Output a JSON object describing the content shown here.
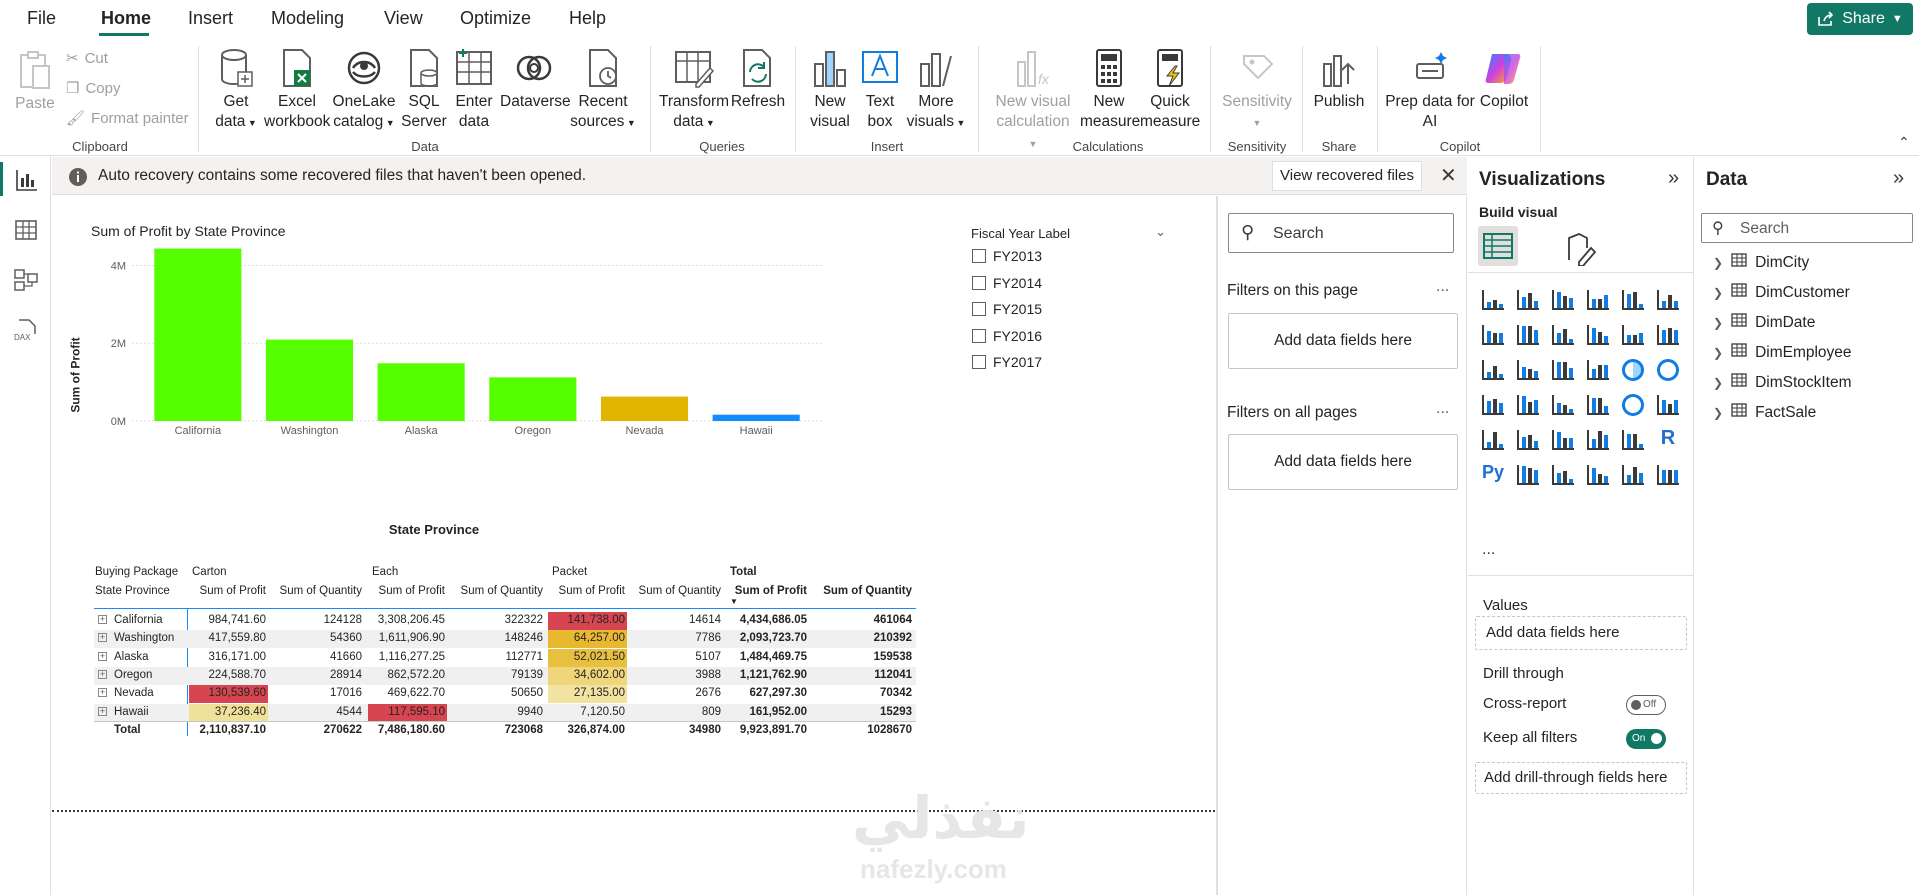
{
  "menu": {
    "tabs": [
      "File",
      "Home",
      "Insert",
      "Modeling",
      "View",
      "Optimize",
      "Help"
    ],
    "share": "Share"
  },
  "ribbon": {
    "clipboard": {
      "paste": "Paste",
      "cut": "Cut",
      "copy": "Copy",
      "format_painter": "Format painter",
      "group": "Clipboard"
    },
    "data": {
      "get_data": [
        "Get",
        "data"
      ],
      "excel": [
        "Excel",
        "workbook"
      ],
      "onelake": [
        "OneLake",
        "catalog"
      ],
      "sql": [
        "SQL",
        "Server"
      ],
      "enter": [
        "Enter",
        "data"
      ],
      "dataverse": "Dataverse",
      "recent": [
        "Recent",
        "sources"
      ],
      "group": "Data"
    },
    "queries": {
      "transform": [
        "Transform",
        "data"
      ],
      "refresh": "Refresh",
      "group": "Queries"
    },
    "insert": {
      "new_visual": [
        "New",
        "visual"
      ],
      "text_box": [
        "Text",
        "box"
      ],
      "more_visuals": [
        "More",
        "visuals"
      ],
      "group": "Insert"
    },
    "calculations": {
      "new_visual_calc": [
        "New visual",
        "calculation"
      ],
      "new_measure": [
        "New",
        "measure"
      ],
      "quick_measure": [
        "Quick",
        "measure"
      ],
      "group": "Calculations"
    },
    "sensitivity": {
      "label": "Sensitivity",
      "group": "Sensitivity"
    },
    "share": {
      "publish": "Publish",
      "group": "Share"
    },
    "copilot": {
      "prep": [
        "Prep data for",
        "AI"
      ],
      "copilot": "Copilot",
      "group": "Copilot"
    }
  },
  "notification": {
    "text": "Auto recovery contains some recovered files that haven't been opened.",
    "button": "View recovered files"
  },
  "chart_data": {
    "type": "bar",
    "title": "Sum of Profit by State Province",
    "xlabel": "State Province",
    "ylabel": "Sum of Profit",
    "categories": [
      "California",
      "Washington",
      "Alaska",
      "Oregon",
      "Nevada",
      "Hawaii"
    ],
    "values": [
      4434686.05,
      2093723.7,
      1484469.75,
      1121762.9,
      627297.3,
      161952.0
    ],
    "colors": [
      "#55ff00",
      "#55ff00",
      "#55ff00",
      "#55ff00",
      "#e1b400",
      "#118dff"
    ],
    "yticks": [
      "4M",
      "2M",
      "0M"
    ],
    "ylim": [
      0,
      4500000
    ]
  },
  "slicer": {
    "title": "Fiscal Year Label",
    "items": [
      "FY2013",
      "FY2014",
      "FY2015",
      "FY2016",
      "FY2017"
    ]
  },
  "matrix": {
    "header1": [
      "Buying Package",
      "Carton",
      "",
      "Each",
      "",
      "Packet",
      "",
      "Total",
      ""
    ],
    "header2": [
      "State Province",
      "Sum of Profit",
      "Sum of Quantity",
      "Sum of Profit",
      "Sum of Quantity",
      "Sum of Profit",
      "Sum of Quantity",
      "Sum of Profit",
      "Sum of Quantity"
    ],
    "rows": [
      [
        "California",
        "984,741.60",
        "124128",
        "3,308,206.45",
        "322322",
        "141,738.00",
        "14614",
        "4,434,686.05",
        "461064"
      ],
      [
        "Washington",
        "417,559.80",
        "54360",
        "1,611,906.90",
        "148246",
        "64,257.00",
        "7786",
        "2,093,723.70",
        "210392"
      ],
      [
        "Alaska",
        "316,171.00",
        "41660",
        "1,116,277.25",
        "112771",
        "52,021.50",
        "5107",
        "1,484,469.75",
        "159538"
      ],
      [
        "Oregon",
        "224,588.70",
        "28914",
        "862,572.20",
        "79139",
        "34,602.00",
        "3988",
        "1,121,762.90",
        "112041"
      ],
      [
        "Nevada",
        "130,539.60",
        "17016",
        "469,622.70",
        "50650",
        "27,135.00",
        "2676",
        "627,297.30",
        "70342"
      ],
      [
        "Hawaii",
        "37,236.40",
        "4544",
        "117,595.10",
        "9940",
        "7,120.50",
        "809",
        "161,952.00",
        "15293"
      ]
    ],
    "total": [
      "Total",
      "2,110,837.10",
      "270622",
      "7,486,180.60",
      "723068",
      "326,874.00",
      "34980",
      "9,923,891.70",
      "1028670"
    ],
    "highlights": {
      "carton": [
        "",
        "",
        "",
        "",
        "#d64550",
        "#f0e199"
      ],
      "each": [
        "",
        "",
        "",
        "",
        "",
        "#d64550"
      ],
      "packet": [
        "#d64550",
        "#e8b830",
        "#e8c040",
        "#f0d67a",
        "#f3e3a0",
        ""
      ]
    }
  },
  "filters": {
    "search": "Search",
    "on_page": "Filters on this page",
    "on_all": "Filters on all pages",
    "add": "Add data fields here",
    "dots": "..."
  },
  "viz": {
    "title": "Visualizations",
    "build": "Build visual",
    "values": "Values",
    "add_fields": "Add data fields here",
    "drill": "Drill through",
    "cross": "Cross-report",
    "cross_state": "Off",
    "keep": "Keep all filters",
    "keep_state": "On",
    "add_drill": "Add drill-through fields here",
    "more": "..."
  },
  "data": {
    "title": "Data",
    "search": "Search",
    "tables": [
      "DimCity",
      "DimCustomer",
      "DimDate",
      "DimEmployee",
      "DimStockItem",
      "FactSale"
    ]
  },
  "watermark": {
    "arabic": "نفذلي",
    "latin": "nafezly.com"
  }
}
